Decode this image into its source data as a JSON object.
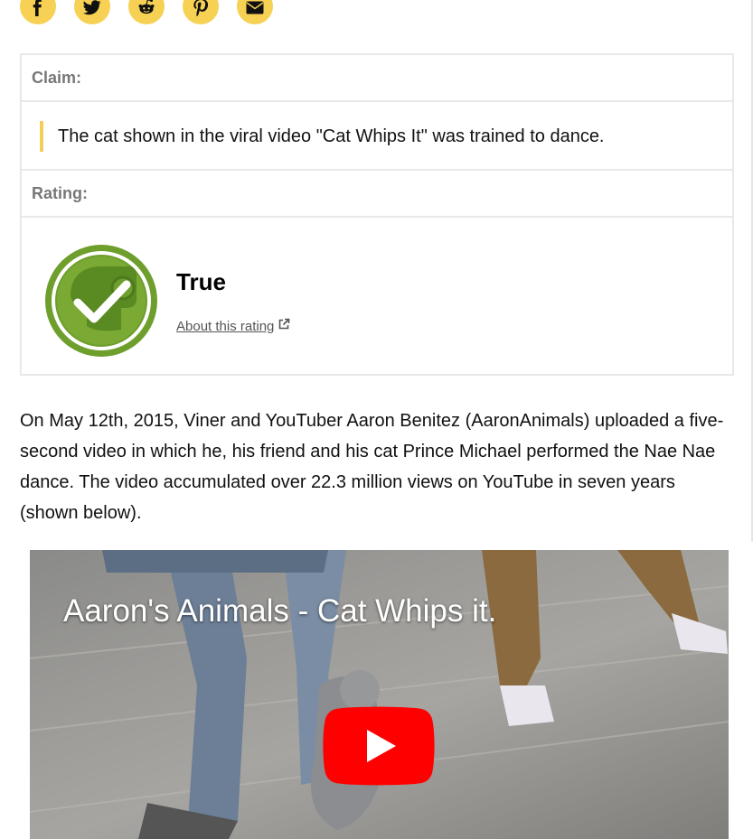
{
  "share": {
    "buttons": [
      {
        "name": "facebook",
        "icon": "facebook-icon"
      },
      {
        "name": "twitter",
        "icon": "twitter-icon"
      },
      {
        "name": "reddit",
        "icon": "reddit-icon"
      },
      {
        "name": "pinterest",
        "icon": "pinterest-icon"
      },
      {
        "name": "email",
        "icon": "envelope-icon"
      }
    ],
    "color": "#f6d154"
  },
  "claim": {
    "label": "Claim:",
    "text": "The cat shown in the viral video \"Cat Whips It\" was trained to dance.",
    "accent": "#f2ce5b"
  },
  "rating": {
    "label": "Rating:",
    "value": "True",
    "badge_icon": "true-checkmark-badge-icon",
    "badge_color": "#6e9e2c",
    "about_link": "About this rating",
    "about_link_icon": "external-link-icon"
  },
  "article": {
    "paragraph": "On May 12th, 2015, Viner and YouTuber Aaron Benitez (AaronAnimals) uploaded a five-second video in which he, his friend and his cat Prince Michael performed the Nae Nae dance. The video accumulated over 22.3 million views on YouTube in seven years (shown below)."
  },
  "video": {
    "title": "Aaron's Animals - Cat Whips it.",
    "play_icon": "youtube-play-icon",
    "play_color": "#ff0000"
  }
}
